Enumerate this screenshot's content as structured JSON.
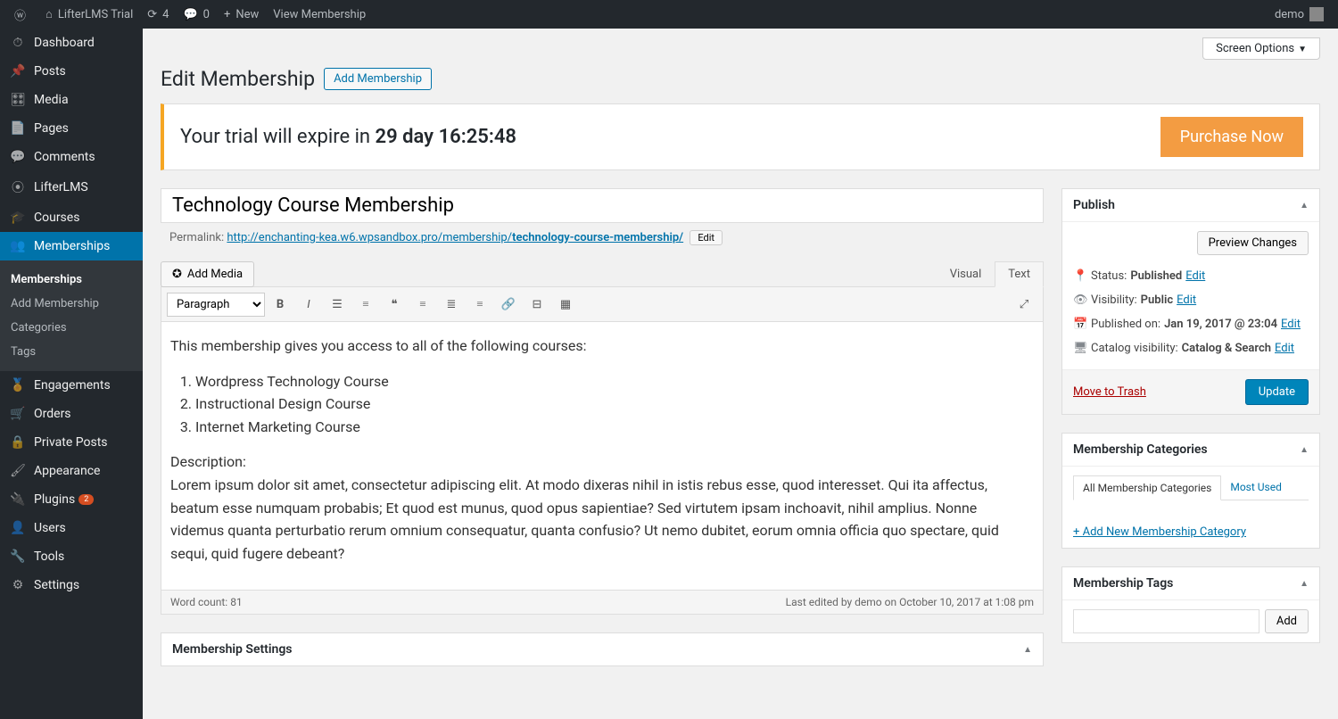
{
  "adminbar": {
    "site_title": "LifterLMS Trial",
    "updates_count": "4",
    "comments_count": "0",
    "new_label": "New",
    "view_label": "View Membership",
    "user": "demo"
  },
  "sidebar": {
    "items": [
      {
        "icon": "⏱",
        "label": "Dashboard"
      },
      {
        "icon": "📌",
        "label": "Posts"
      },
      {
        "icon": "🎛",
        "label": "Media"
      },
      {
        "icon": "📄",
        "label": "Pages"
      },
      {
        "icon": "💬",
        "label": "Comments"
      },
      {
        "icon": "⦿",
        "label": "LifterLMS"
      },
      {
        "icon": "🎓",
        "label": "Courses"
      },
      {
        "icon": "👥",
        "label": "Memberships",
        "current": true
      },
      {
        "icon": "🏅",
        "label": "Engagements"
      },
      {
        "icon": "🛒",
        "label": "Orders"
      },
      {
        "icon": "🔒",
        "label": "Private Posts"
      },
      {
        "icon": "🖌",
        "label": "Appearance"
      },
      {
        "icon": "🔌",
        "label": "Plugins",
        "badge": "2"
      },
      {
        "icon": "👤",
        "label": "Users"
      },
      {
        "icon": "🔧",
        "label": "Tools"
      },
      {
        "icon": "⚙",
        "label": "Settings"
      }
    ],
    "submenu": [
      {
        "label": "Memberships",
        "current": true
      },
      {
        "label": "Add Membership"
      },
      {
        "label": "Categories"
      },
      {
        "label": "Tags"
      }
    ]
  },
  "screen_options": "Screen Options",
  "page_title": "Edit Membership",
  "add_btn": "Add Membership",
  "trial": {
    "prefix": "Your trial will expire in ",
    "time": "29 day 16:25:48",
    "purchase": "Purchase Now"
  },
  "post": {
    "title": "Technology Course Membership",
    "permalink_label": "Permalink:",
    "permalink_base": "http://enchanting-kea.w6.wpsandbox.pro/membership/",
    "permalink_slug": "technology-course-membership/",
    "edit_btn": "Edit",
    "content_intro": "This membership gives you access to all of the following courses:",
    "content_list": [
      "Wordpress Technology Course",
      "Instructional Design Course",
      "Internet Marketing Course"
    ],
    "desc_label": "Description:",
    "desc_body": "Lorem ipsum dolor sit amet, consectetur adipiscing elit. At modo dixeras nihil in istis rebus esse, quod interesset. Qui ita affectus, beatum esse numquam probabis; Et quod est munus, quod opus sapientiae? Sed virtutem ipsam inchoavit, nihil amplius. Nonne videmus quanta perturbatio rerum omnium consequatur, quanta confusio? Ut nemo dubitet, eorum omnia officia quo spectare, quid sequi, quid fugere debeant?",
    "word_count_label": "Word count: ",
    "word_count": "81",
    "last_edited": "Last edited by demo on October 10, 2017 at 1:08 pm"
  },
  "editor": {
    "add_media": "Add Media",
    "tab_visual": "Visual",
    "tab_text": "Text",
    "format_select": "Paragraph"
  },
  "settings_box": "Membership Settings",
  "publish": {
    "title": "Publish",
    "preview": "Preview Changes",
    "status_label": "Status:",
    "status_value": "Published",
    "visibility_label": "Visibility:",
    "visibility_value": "Public",
    "published_label": "Published on:",
    "published_value": "Jan 19, 2017 @ 23:04",
    "catalog_label": "Catalog visibility:",
    "catalog_value": "Catalog & Search",
    "edit_link": "Edit",
    "trash": "Move to Trash",
    "update": "Update"
  },
  "categories": {
    "title": "Membership Categories",
    "tab_all": "All Membership Categories",
    "tab_most": "Most Used",
    "add_new": "+ Add New Membership Category"
  },
  "tags": {
    "title": "Membership Tags",
    "add_btn": "Add"
  }
}
